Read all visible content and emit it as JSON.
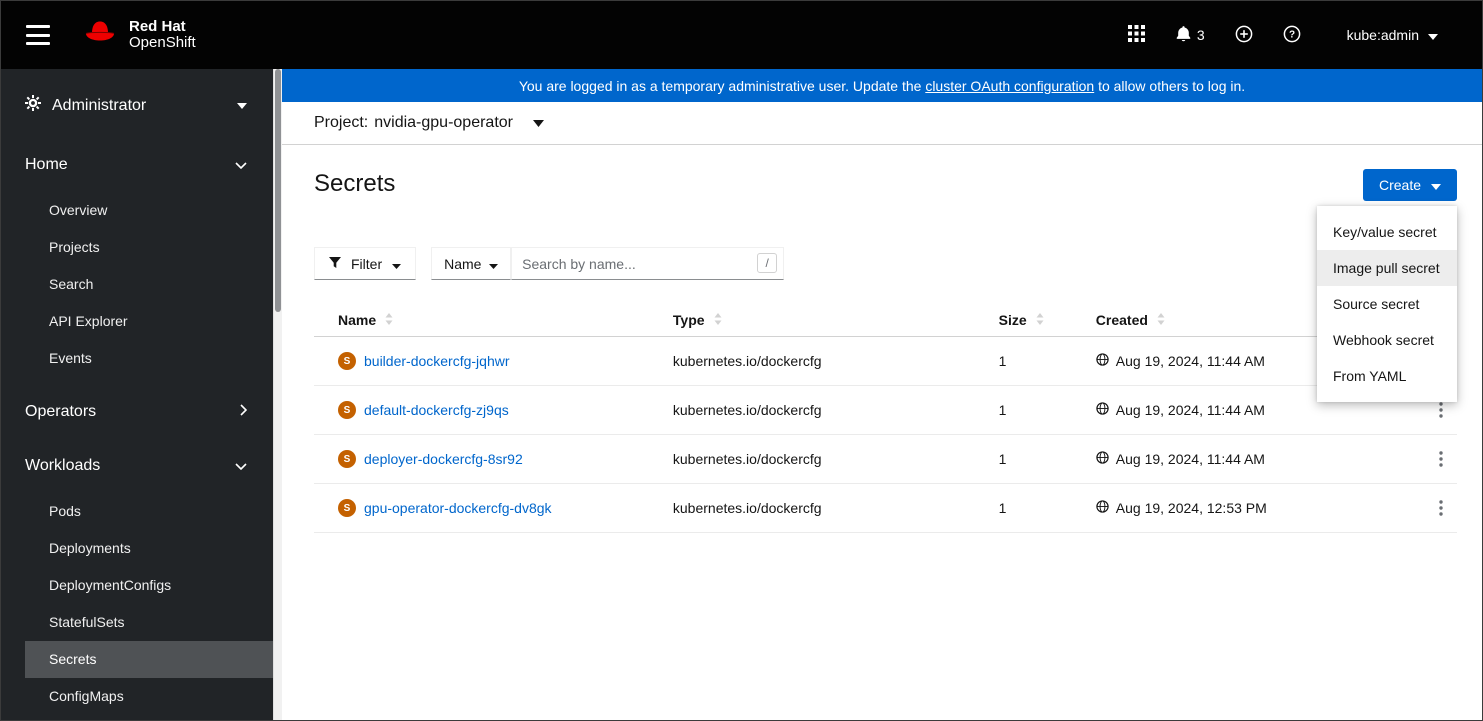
{
  "masthead": {
    "brand_line1": "Red Hat",
    "brand_line2": "OpenShift",
    "notification_count": "3",
    "user_label": "kube:admin"
  },
  "banner": {
    "prefix": "You are logged in as a temporary administrative user. Update the ",
    "link_text": "cluster OAuth configuration",
    "suffix": " to allow others to log in."
  },
  "sidebar": {
    "perspective": "Administrator",
    "groups": [
      {
        "label": "Home",
        "expanded": true,
        "items": [
          "Overview",
          "Projects",
          "Search",
          "API Explorer",
          "Events"
        ]
      },
      {
        "label": "Operators",
        "expanded": false,
        "items": []
      },
      {
        "label": "Workloads",
        "expanded": true,
        "items": [
          "Pods",
          "Deployments",
          "DeploymentConfigs",
          "StatefulSets",
          "Secrets",
          "ConfigMaps"
        ]
      }
    ],
    "active_item": "Secrets"
  },
  "project_bar": {
    "label": "Project:",
    "value": "nvidia-gpu-operator"
  },
  "page": {
    "title": "Secrets"
  },
  "create": {
    "button_label": "Create",
    "menu_items": [
      "Key/value secret",
      "Image pull secret",
      "Source secret",
      "Webhook secret",
      "From YAML"
    ],
    "highlighted_item": "Image pull secret"
  },
  "toolbar": {
    "filter_label": "Filter",
    "attribute_label": "Name",
    "search_placeholder": "Search by name...",
    "search_value": "",
    "shortcut_hint": "/"
  },
  "table": {
    "headers": [
      "Name",
      "Type",
      "Size",
      "Created"
    ],
    "resource_badge": "S",
    "rows": [
      {
        "name": "builder-dockercfg-jqhwr",
        "type": "kubernetes.io/dockercfg",
        "size": "1",
        "created": "Aug 19, 2024, 11:44 AM"
      },
      {
        "name": "default-dockercfg-zj9qs",
        "type": "kubernetes.io/dockercfg",
        "size": "1",
        "created": "Aug 19, 2024, 11:44 AM"
      },
      {
        "name": "deployer-dockercfg-8sr92",
        "type": "kubernetes.io/dockercfg",
        "size": "1",
        "created": "Aug 19, 2024, 11:44 AM"
      },
      {
        "name": "gpu-operator-dockercfg-dv8gk",
        "type": "kubernetes.io/dockercfg",
        "size": "1",
        "created": "Aug 19, 2024, 12:53 PM"
      }
    ]
  },
  "colors": {
    "accent": "#0066cc",
    "banner": "#0066cc",
    "masthead": "#030303",
    "sidebar": "#212427",
    "sidebar_active": "#4f5255",
    "secret_badge": "#c46100"
  },
  "icons": {
    "menu": "hamburger",
    "brand": "red-hat-fedora",
    "app_launcher": "grid-3x3",
    "notifications": "bell",
    "add": "plus-circle",
    "help": "question-circle",
    "perspective": "gear",
    "filter": "funnel",
    "sort": "arrows-vertical",
    "created": "globe",
    "row_actions": "kebab-vertical",
    "resource_badge": "S"
  }
}
